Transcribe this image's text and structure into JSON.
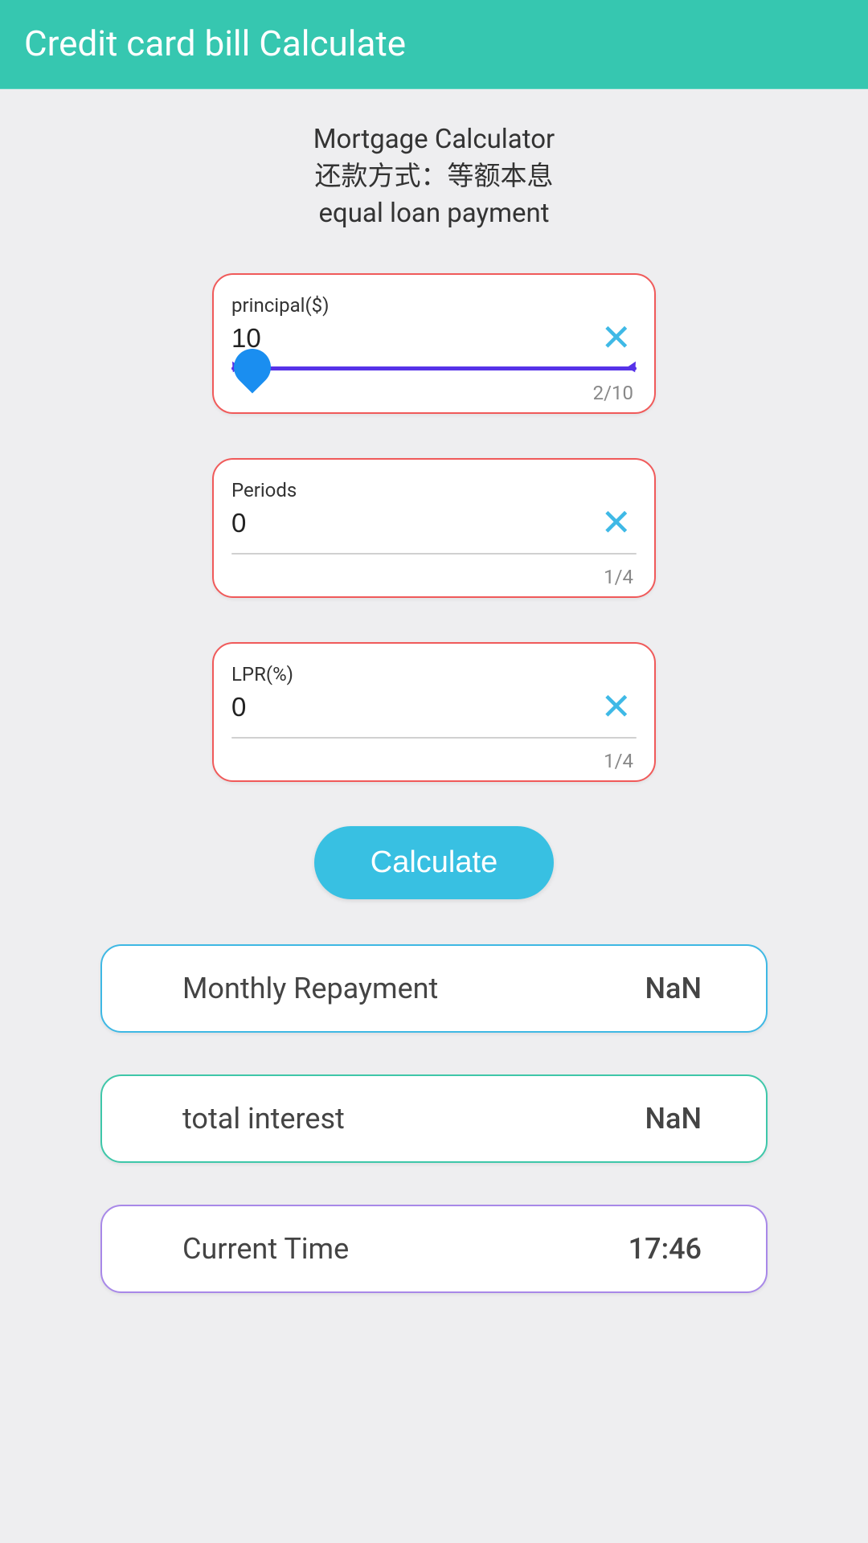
{
  "header": {
    "title": "Credit card bill Calculate"
  },
  "titleBlock": {
    "line1": "Mortgage Calculator",
    "line2": "还款方式：等额本息",
    "line3": "equal loan payment"
  },
  "inputs": {
    "principal": {
      "label": "principal($)",
      "value": "10",
      "counter": "2/10"
    },
    "periods": {
      "label": "Periods",
      "value": "0",
      "counter": "1/4"
    },
    "lpr": {
      "label": "LPR(%)",
      "value": "0",
      "counter": "1/4"
    }
  },
  "calculateLabel": "Calculate",
  "results": {
    "monthly": {
      "label": "Monthly Repayment",
      "value": "NaN"
    },
    "interest": {
      "label": "total interest",
      "value": "NaN"
    },
    "time": {
      "label": "Current Time",
      "value": "17:46"
    }
  }
}
